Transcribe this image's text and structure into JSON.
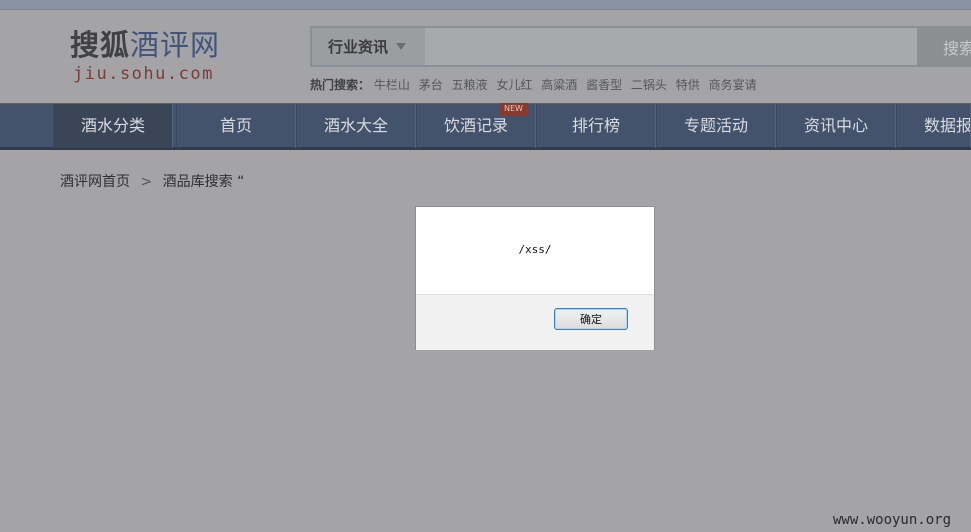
{
  "logo": {
    "sohu": "搜狐",
    "jiu": "酒评网",
    "domain": "jiu.sohu.com"
  },
  "search": {
    "category": "行业资讯",
    "query": "",
    "placeholder": "",
    "button_label": "搜索",
    "hot_label": "热门搜索：",
    "hot_terms": [
      "牛栏山",
      "茅台",
      "五粮液",
      "女儿红",
      "高粱酒",
      "酱香型",
      "二锅头",
      "特供",
      "商务宴请"
    ]
  },
  "nav": {
    "items": [
      "酒水分类",
      "首页",
      "酒水大全",
      "饮酒记录",
      "排行榜",
      "专题活动",
      "资讯中心",
      "数据报告"
    ],
    "new_badge": "NEW"
  },
  "breadcrumb": {
    "home": "酒评网首页",
    "separator": ">",
    "current": "酒品库搜索 “"
  },
  "dialog": {
    "message": "/xss/",
    "ok_label": "确定"
  },
  "watermark": "www.wooyun.org",
  "colors": {
    "nav_bg": "#44536b",
    "overlay": "#a4a4a7",
    "logo_blue": "#41557c",
    "logo_red": "#7a3c3c"
  }
}
